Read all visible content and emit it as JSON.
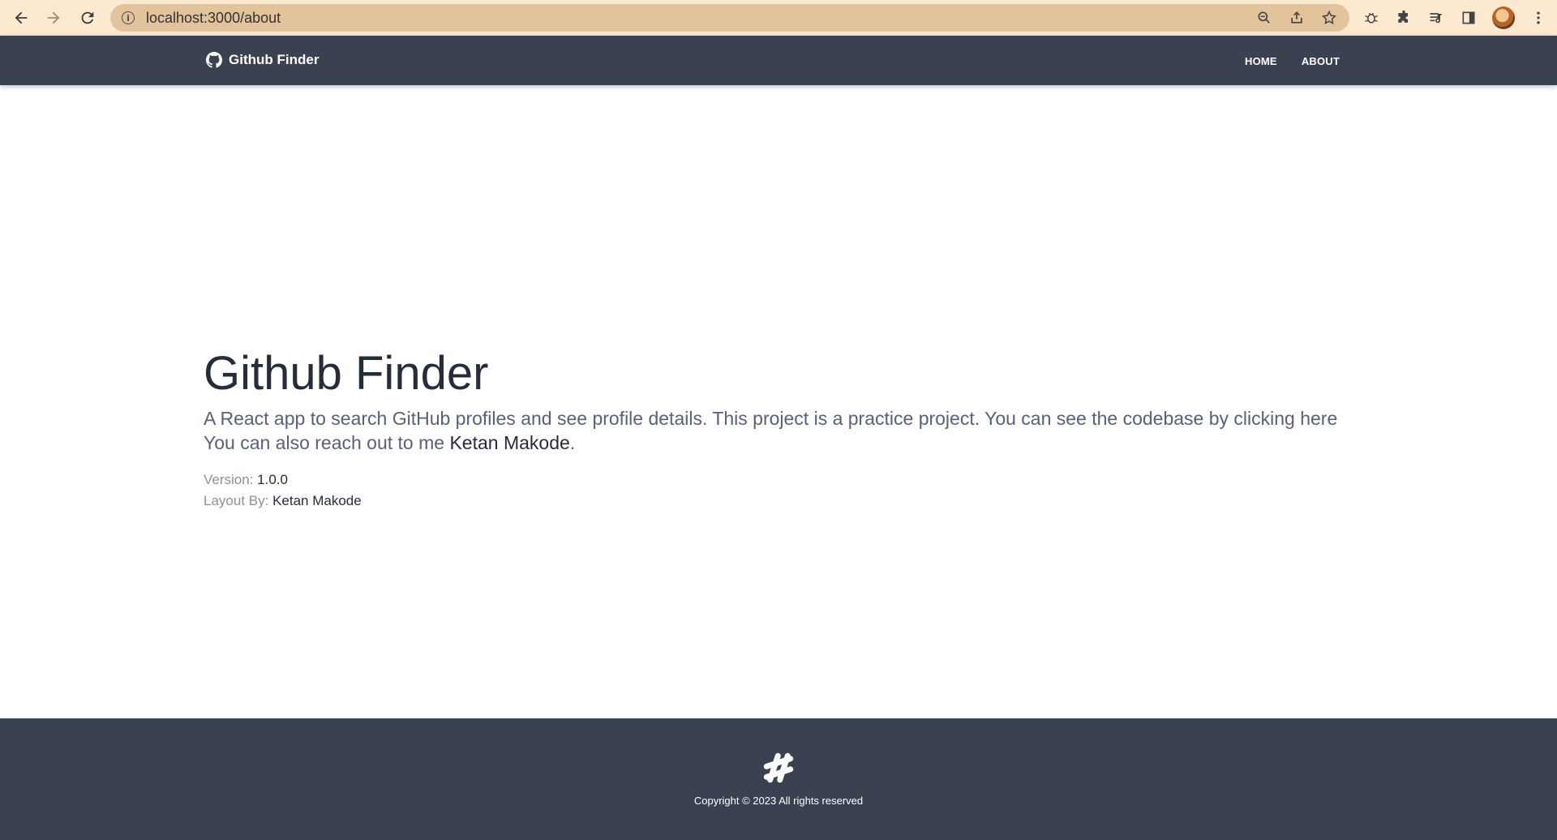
{
  "browser": {
    "url": "localhost:3000/about",
    "icons": [
      "back-icon",
      "forward-icon",
      "reload-icon",
      "info-icon",
      "zoom-icon",
      "share-icon",
      "star-icon",
      "bug-icon",
      "extensions-icon",
      "media-icon",
      "sidepanel-icon",
      "profile-avatar",
      "menu-icon"
    ]
  },
  "navbar": {
    "brand": "Github Finder",
    "links": [
      {
        "label": "HOME"
      },
      {
        "label": "ABOUT"
      }
    ]
  },
  "main": {
    "title": "Github Finder",
    "description": "A React app to search GitHub profiles and see profile details. This project is a practice project. You can see the codebase by clicking here You can also reach out to me",
    "author_link": "Ketan Makode",
    "period": ".",
    "version_label": "Version: ",
    "version_value": "1.0.0",
    "layout_label": "Layout By: ",
    "layout_value": "Ketan Makode"
  },
  "footer": {
    "copyright": "Copyright © 2023 All rights reserved"
  }
}
